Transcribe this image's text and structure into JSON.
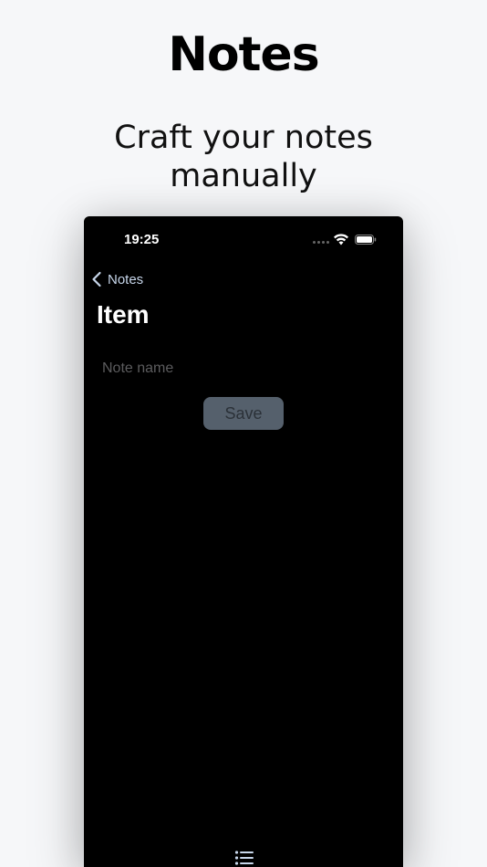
{
  "promo": {
    "title": "Notes",
    "subtitle": "Craft your notes manually"
  },
  "status_bar": {
    "time": "19:25",
    "signal_icon": "signal-dots-icon",
    "wifi_icon": "wifi-icon",
    "battery_icon": "battery-icon"
  },
  "nav": {
    "back_label": "Notes",
    "back_icon": "chevron-left-icon",
    "title": "Item"
  },
  "form": {
    "note_name_placeholder": "Note name",
    "note_name_value": "",
    "save_label": "Save"
  },
  "tab_bar": {
    "icon": "list-icon"
  },
  "colors": {
    "page_background": "#f6f7f9",
    "phone_background": "#000000",
    "accent": "#c7d6ea",
    "save_button_bg": "#55606c",
    "save_button_text": "#2b3138",
    "placeholder": "#5c5c5e"
  }
}
